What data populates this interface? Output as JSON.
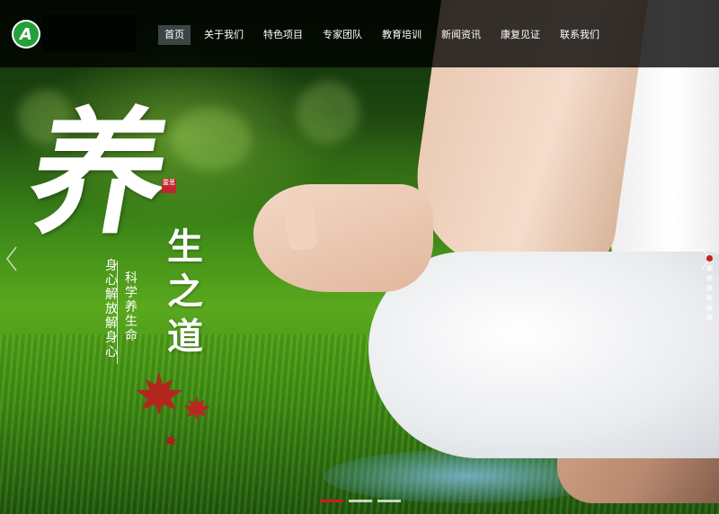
{
  "site": {
    "logo_letter": "A"
  },
  "nav": {
    "items": [
      {
        "label": "首页",
        "active": true
      },
      {
        "label": "关于我们",
        "active": false
      },
      {
        "label": "特色项目",
        "active": false
      },
      {
        "label": "专家团队",
        "active": false
      },
      {
        "label": "教育培训",
        "active": false
      },
      {
        "label": "新闻资讯",
        "active": false
      },
      {
        "label": "康复见证",
        "active": false
      },
      {
        "label": "联系我们",
        "active": false
      }
    ]
  },
  "banner": {
    "big_char": "养",
    "column_chars": "生之道",
    "seal_text": "靈思",
    "line1": "科学养生命",
    "line2": "身心解放解身心",
    "accent_color": "#d0181f"
  },
  "slider": {
    "vertical_dots_count": 7,
    "active_dot": 0,
    "pager_count": 3,
    "active_page": 0,
    "prev_icon": "chevron-left-icon",
    "next_icon": "chevron-right-icon"
  }
}
